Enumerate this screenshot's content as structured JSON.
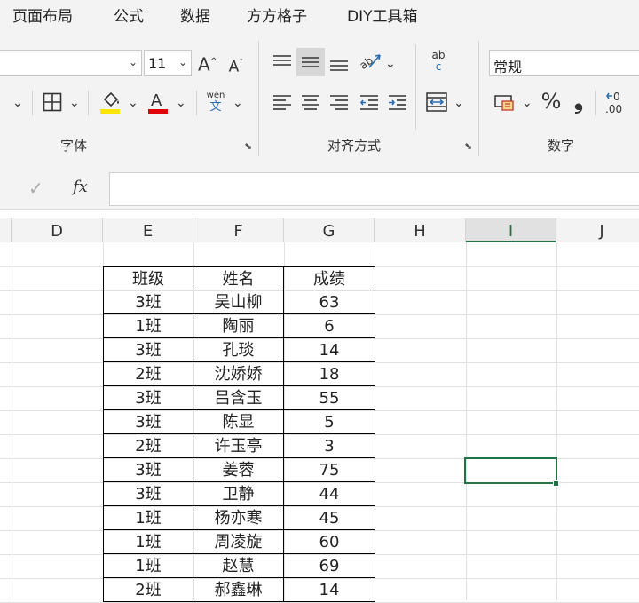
{
  "menu": {
    "tabs": [
      "页面布局",
      "公式",
      "数据",
      "方方格子",
      "DIY工具箱"
    ]
  },
  "ribbon": {
    "font_size": "11",
    "grow_font": "A",
    "shrink_font": "A",
    "font_group_label": "字体",
    "align_group_label": "对齐方式",
    "number_group_label": "数字",
    "number_format": "常规",
    "phonetic_top": "wén",
    "phonetic_bottom": "文",
    "percent": "%",
    "comma": "❟",
    "wrap_glyph_top": "ab",
    "wrap_glyph_bottom": "c",
    "decimal_glyph": ".00"
  },
  "formula_bar": {
    "fx": "fx",
    "check": "✓",
    "value": ""
  },
  "columns": [
    "D",
    "E",
    "F",
    "G",
    "H",
    "I",
    "J"
  ],
  "selected_column": "I",
  "table": {
    "headers": [
      "班级",
      "姓名",
      "成绩"
    ],
    "rows": [
      [
        "3班",
        "吴山柳",
        "63"
      ],
      [
        "1班",
        "陶丽",
        "6"
      ],
      [
        "3班",
        "孔琰",
        "14"
      ],
      [
        "2班",
        "沈娇娇",
        "18"
      ],
      [
        "3班",
        "吕含玉",
        "55"
      ],
      [
        "3班",
        "陈显",
        "5"
      ],
      [
        "2班",
        "许玉亭",
        "3"
      ],
      [
        "3班",
        "姜蓉",
        "75"
      ],
      [
        "3班",
        "卫静",
        "44"
      ],
      [
        "1班",
        "杨亦寒",
        "45"
      ],
      [
        "1班",
        "周凌旋",
        "60"
      ],
      [
        "1班",
        "赵慧",
        "69"
      ],
      [
        "2班",
        "郝鑫琳",
        "14"
      ]
    ]
  },
  "colors": {
    "accent": "#217346",
    "fill_yellow": "#ffe600",
    "font_red": "#e00000"
  },
  "icons": [
    "borders-icon",
    "fill-color-icon",
    "font-color-icon",
    "phonetic-icon",
    "align-top-icon",
    "align-middle-icon",
    "align-bottom-icon",
    "orientation-icon",
    "wrap-text-icon",
    "align-left-icon",
    "align-center-icon",
    "align-right-icon",
    "decrease-indent-icon",
    "increase-indent-icon",
    "merge-center-icon",
    "accounting-format-icon",
    "percent-icon",
    "comma-style-icon",
    "increase-decimal-icon",
    "dialog-launcher-icon",
    "check-icon",
    "fx-icon"
  ]
}
